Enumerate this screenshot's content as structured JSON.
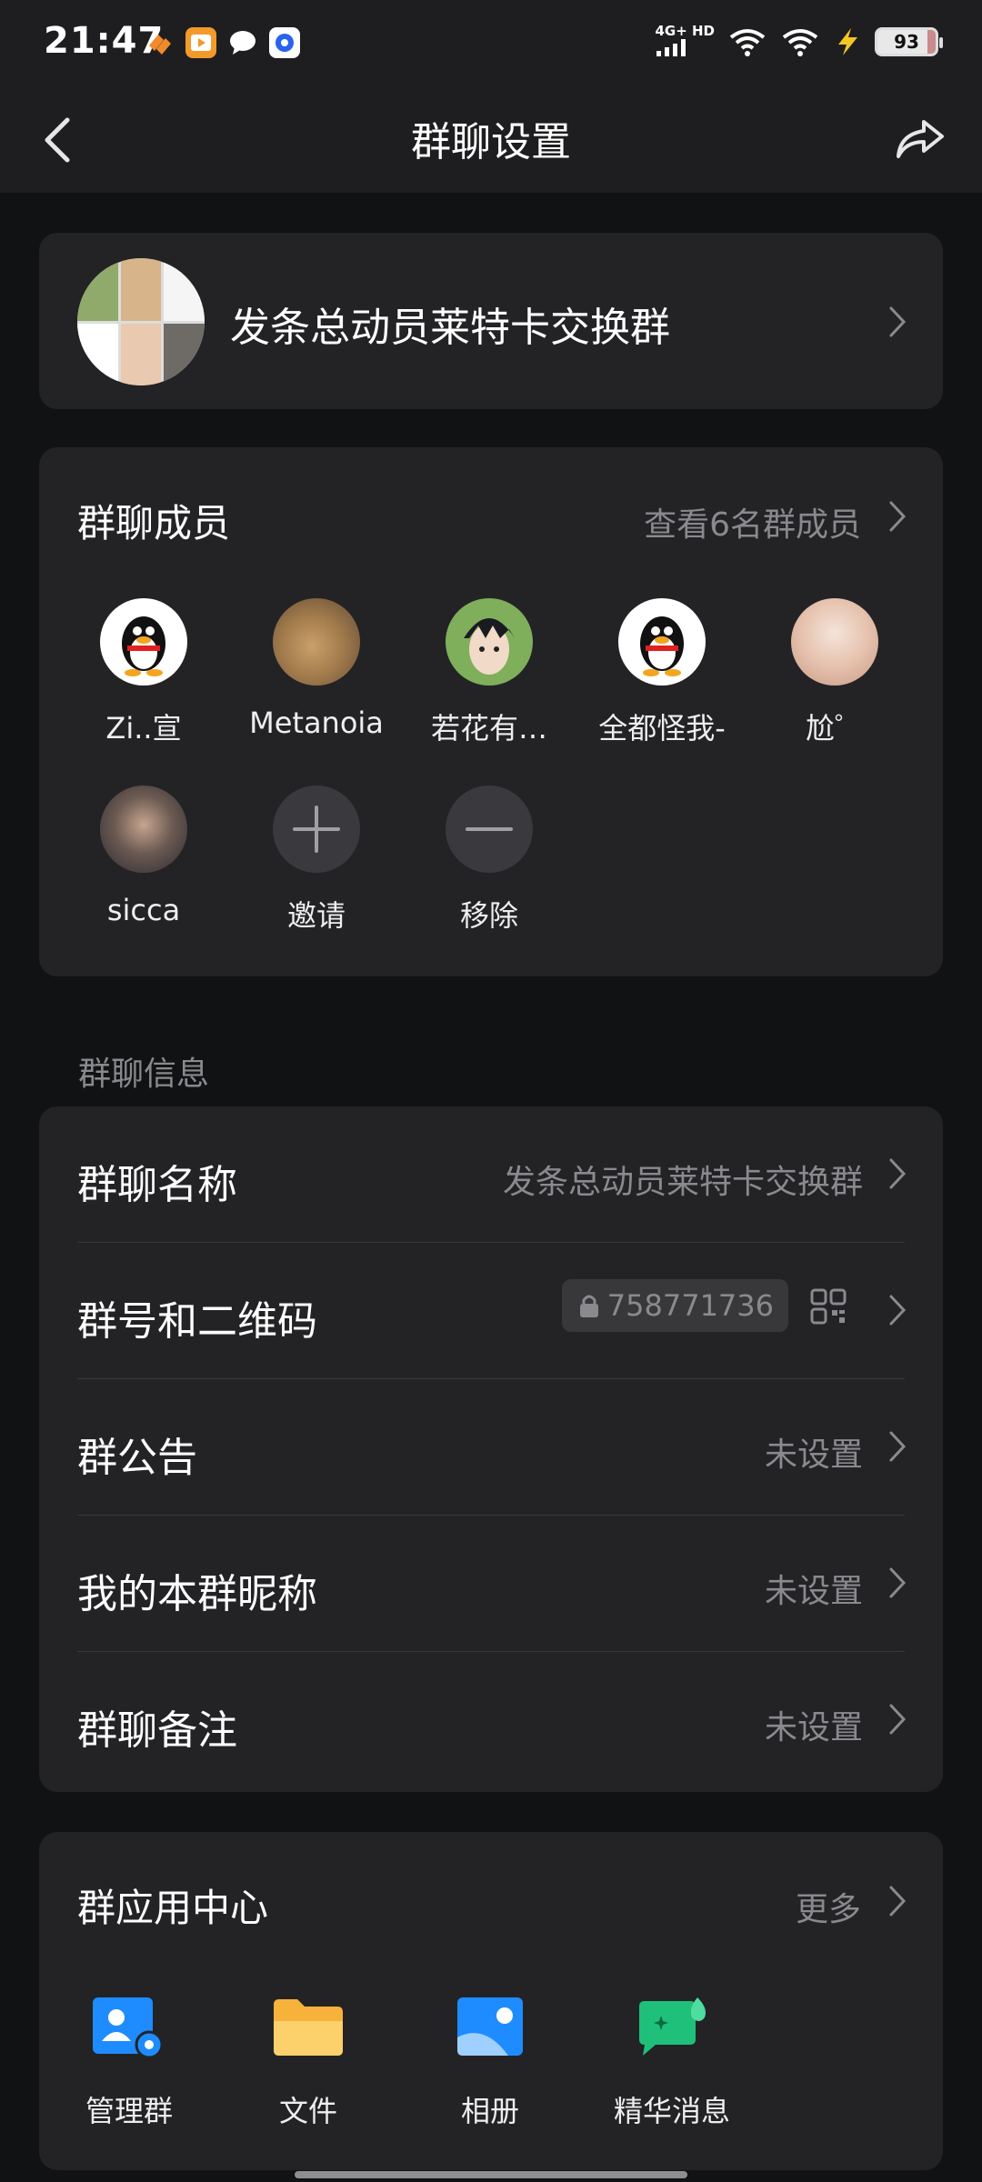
{
  "status_bar": {
    "time": "21:47",
    "network_label": "4G+ HD",
    "battery": "93",
    "icons": [
      "cellular-signal-icon",
      "wifi-icon",
      "wifi-icon",
      "charging-icon"
    ]
  },
  "nav": {
    "title": "群聊设置",
    "back_icon": "chevron-left-icon",
    "share_icon": "share-icon"
  },
  "group": {
    "name": "发条总动员莱特卡交换群"
  },
  "members": {
    "title": "群聊成员",
    "view_all": "查看6名群成员",
    "list": [
      {
        "name": "Zi..宣"
      },
      {
        "name": "Metanoia"
      },
      {
        "name": "若花有…"
      },
      {
        "name": "全都怪我-"
      },
      {
        "name": "尬゜"
      },
      {
        "name": "sicca"
      }
    ],
    "invite_label": "邀请",
    "remove_label": "移除"
  },
  "info": {
    "section_label": "群聊信息",
    "rows": {
      "name": {
        "key": "群聊名称",
        "value": "发条总动员莱特卡交换群"
      },
      "number": {
        "key": "群号和二维码",
        "value": "758771736"
      },
      "notice": {
        "key": "群公告",
        "value": "未设置"
      },
      "nickname": {
        "key": "我的本群昵称",
        "value": "未设置"
      },
      "remark": {
        "key": "群聊备注",
        "value": "未设置"
      }
    }
  },
  "apps": {
    "title": "群应用中心",
    "more": "更多",
    "list": [
      {
        "name": "管理群",
        "icon": "manage-group-icon"
      },
      {
        "name": "文件",
        "icon": "folder-icon"
      },
      {
        "name": "相册",
        "icon": "album-icon"
      },
      {
        "name": "精华消息",
        "icon": "essence-message-icon"
      }
    ]
  },
  "colors": {
    "background": "#111214",
    "card": "#232326",
    "secondary_text": "#8a8a8e",
    "accent_blue": "#1e8cff",
    "accent_orange": "#f7b23b",
    "accent_green": "#1fc07a"
  }
}
